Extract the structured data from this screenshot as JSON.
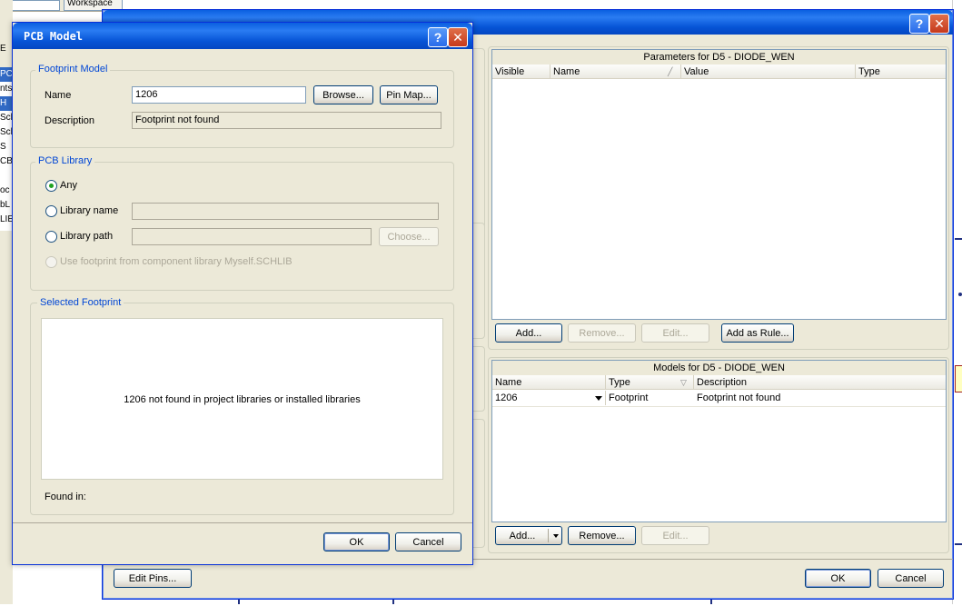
{
  "background": {
    "workspace_button": "Workspace",
    "left_list": [
      "E",
      "PC",
      "nts",
      "H",
      "Sch",
      "Sch",
      "S",
      "CB",
      "",
      "oc",
      "bL",
      "LIE"
    ]
  },
  "main_dialog": {
    "parameters_panel": {
      "title": "Parameters for D5 - DIODE_WEN",
      "columns": [
        "Visible",
        "Name",
        "Value",
        "Type"
      ],
      "buttons": {
        "add": "Add...",
        "remove": "Remove...",
        "edit": "Edit...",
        "add_as_rule": "Add as Rule..."
      }
    },
    "models_panel": {
      "title": "Models for D5 - DIODE_WEN",
      "columns": [
        "Name",
        "Type",
        "Description"
      ],
      "rows": [
        {
          "name": "1206",
          "type": "Footprint",
          "description": "Footprint not found"
        }
      ],
      "buttons": {
        "add": "Add...",
        "remove": "Remove...",
        "edit": "Edit..."
      }
    },
    "footer": {
      "edit_pins": "Edit Pins...",
      "ok": "OK",
      "cancel": "Cancel"
    },
    "help_glyph": "?",
    "close_glyph": "✕"
  },
  "pcb_model_dialog": {
    "title": "PCB Model",
    "help_glyph": "?",
    "close_glyph": "✕",
    "footprint_model": {
      "group_label": "Footprint Model",
      "name_label": "Name",
      "name_value": "1206",
      "browse_button": "Browse...",
      "pin_map_button": "Pin Map...",
      "description_label": "Description",
      "description_value": "Footprint not found"
    },
    "pcb_library": {
      "group_label": "PCB Library",
      "options": {
        "any": "Any",
        "library_name": "Library name",
        "library_path": "Library path",
        "use_component_library": "Use footprint from component library Myself.SCHLIB"
      },
      "selected": "any",
      "choose_button": "Choose..."
    },
    "selected_footprint": {
      "group_label": "Selected Footprint",
      "message": "1206 not found in project libraries or installed libraries",
      "found_in_label": "Found in:"
    },
    "ok_button": "OK",
    "cancel_button": "Cancel"
  }
}
